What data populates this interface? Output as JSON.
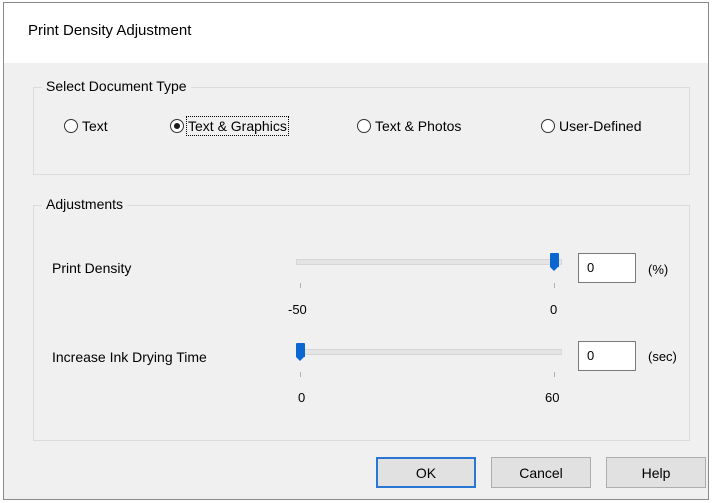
{
  "dialog": {
    "title": "Print Density Adjustment"
  },
  "document_type": {
    "group_label": "Select Document Type",
    "options": [
      {
        "label": "Text",
        "selected": false
      },
      {
        "label": "Text & Graphics",
        "selected": true
      },
      {
        "label": "Text & Photos",
        "selected": false
      },
      {
        "label": "User-Defined",
        "selected": false
      }
    ]
  },
  "adjustments": {
    "group_label": "Adjustments",
    "print_density": {
      "label": "Print Density",
      "min_label": "-50",
      "max_label": "0",
      "value": "0",
      "unit": "(%)",
      "min": -50,
      "max": 0
    },
    "ink_drying": {
      "label": "Increase Ink Drying Time",
      "min_label": "0",
      "max_label": "60",
      "value": "0",
      "unit": "(sec)",
      "min": 0,
      "max": 60
    }
  },
  "buttons": {
    "ok": "OK",
    "cancel": "Cancel",
    "help": "Help"
  },
  "colors": {
    "slider_thumb": "#0a66d1",
    "dialog_bg": "#f0f0f0",
    "default_button_border": "#2a77d3"
  }
}
